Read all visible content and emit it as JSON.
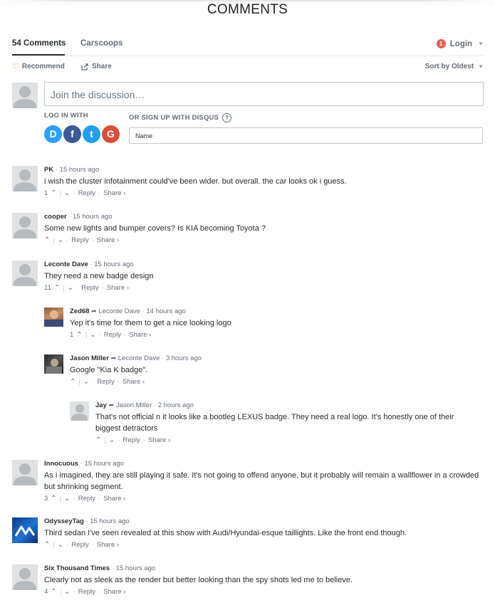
{
  "header": {
    "title": "COMMENTS"
  },
  "tabs": {
    "comments": "54 Comments",
    "forum": "Carscoops"
  },
  "login": {
    "badge": "1",
    "label": "Login"
  },
  "actions": {
    "recommend": "Recommend",
    "share": "Share",
    "sort": "Sort by Oldest"
  },
  "composer": {
    "placeholder": "Join the discussion…",
    "login_with": "LOG IN WITH",
    "signup_with": "OR SIGN UP WITH DISQUS",
    "help_glyph": "?",
    "name_placeholder": "Name",
    "social_letters": {
      "disqus": "D",
      "facebook": "f",
      "twitter": "t",
      "google": "G"
    }
  },
  "labels": {
    "reply": "Reply",
    "share": "Share ›",
    "sep": "·"
  },
  "colors": {
    "accent": "#e8604c",
    "disqus": "#2e9fff",
    "facebook": "#3b5998",
    "twitter": "#1da1f2",
    "google": "#dd4b39"
  },
  "comments": [
    {
      "author": "PK",
      "time": "15 hours ago",
      "text": "i wish the cluster infotainment could've been wider. but overall. the car looks ok i guess.",
      "votes": "1"
    },
    {
      "author": "cooper",
      "time": "15 hours ago",
      "text": "Some new lights and bumper covers? Is KIA becoming Toyota ?",
      "votes": ""
    },
    {
      "author": "Leconte Dave",
      "time": "15 hours ago",
      "text": "They need a new badge design",
      "votes": "11"
    },
    {
      "author": "Zed68",
      "reply_to": "Leconte Dave",
      "time": "14 hours ago",
      "text": "Yep it's time for them to get a nice looking logo",
      "votes": "1"
    },
    {
      "author": "Jason Miller",
      "reply_to": "Leconte Dave",
      "time": "3 hours ago",
      "text": "Google \"Kia K badge\".",
      "votes": ""
    },
    {
      "author": "Jay",
      "reply_to": "Jason Miller",
      "time": "2 hours ago",
      "text": "That's not official n it looks like a bootleg LEXUS badge. They need a real logo. It's honestly one of their biggest detractors",
      "votes": ""
    },
    {
      "author": "Innocuous",
      "time": "15 hours ago",
      "text": "As i imagined, they are still playing it safe. It's not going to offend anyone, but it probably will remain a wallflower in a crowded but shrinking segment.",
      "votes": "3"
    },
    {
      "author": "OdysseyTag",
      "time": "15 hours ago",
      "text": "Third sedan I've seen revealed at this show with Audi/Hyundai-esque taillights. Like the front end though.",
      "votes": ""
    },
    {
      "author": "Six Thousand Times",
      "time": "15 hours ago",
      "text": "Clearly not as sleek as the render but better looking than the spy shots led me to believe.",
      "votes": "4"
    }
  ]
}
